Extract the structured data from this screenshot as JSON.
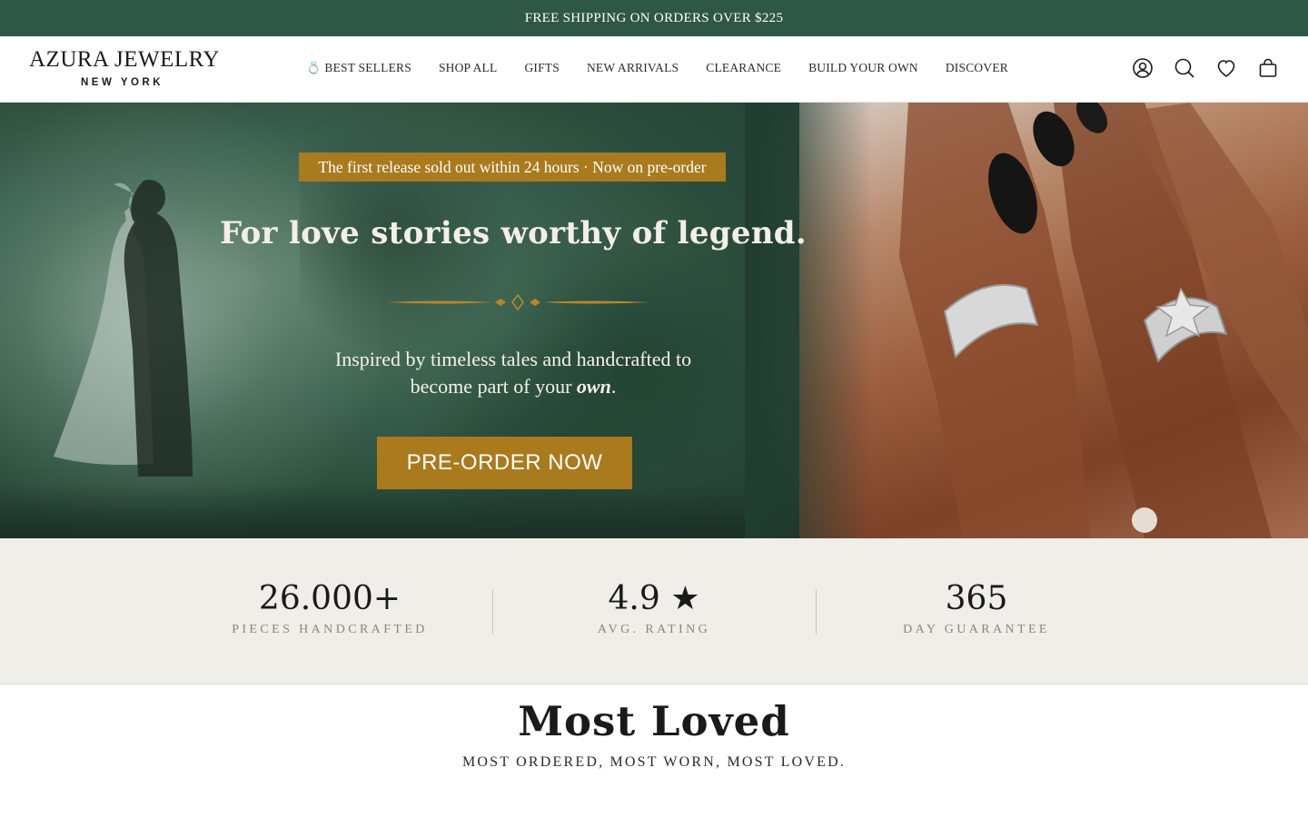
{
  "promo_bar": {
    "text": "FREE SHIPPING ON ORDERS OVER $225"
  },
  "header": {
    "logo_main": "AZURA JEWELRY",
    "logo_sub": "NEW YORK",
    "nav": [
      {
        "label": "BEST SELLERS",
        "icon": "ring-icon"
      },
      {
        "label": "SHOP ALL"
      },
      {
        "label": "GIFTS"
      },
      {
        "label": "NEW ARRIVALS"
      },
      {
        "label": "CLEARANCE"
      },
      {
        "label": "BUILD YOUR OWN"
      },
      {
        "label": "DISCOVER"
      }
    ],
    "icons": [
      "account-icon",
      "search-icon",
      "wishlist-heart-icon",
      "cart-bag-icon"
    ]
  },
  "hero": {
    "badge": "The first release sold out within 24 hours · Now on pre-order",
    "title": "For love stories worthy of legend.",
    "subtitle_line1": "Inspired by timeless tales and handcrafted to",
    "subtitle_line2_prefix": "become part of your ",
    "subtitle_line2_em": "own",
    "subtitle_line2_suffix": ".",
    "cta": "PRE-ORDER NOW",
    "accent_color": "#a97a1e"
  },
  "stats": [
    {
      "value": "26.000+",
      "label": "PIECES HANDCRAFTED"
    },
    {
      "value": "4.9 ★",
      "label": "AVG. RATING"
    },
    {
      "value": "365",
      "label": "DAY GUARANTEE"
    }
  ],
  "most_loved": {
    "title": "Most Loved",
    "subtitle": "MOST ORDERED, MOST WORN, MOST LOVED."
  },
  "colors": {
    "brand_green": "#2f5745",
    "gold": "#a97a1e",
    "stats_bg": "#efeee9"
  }
}
